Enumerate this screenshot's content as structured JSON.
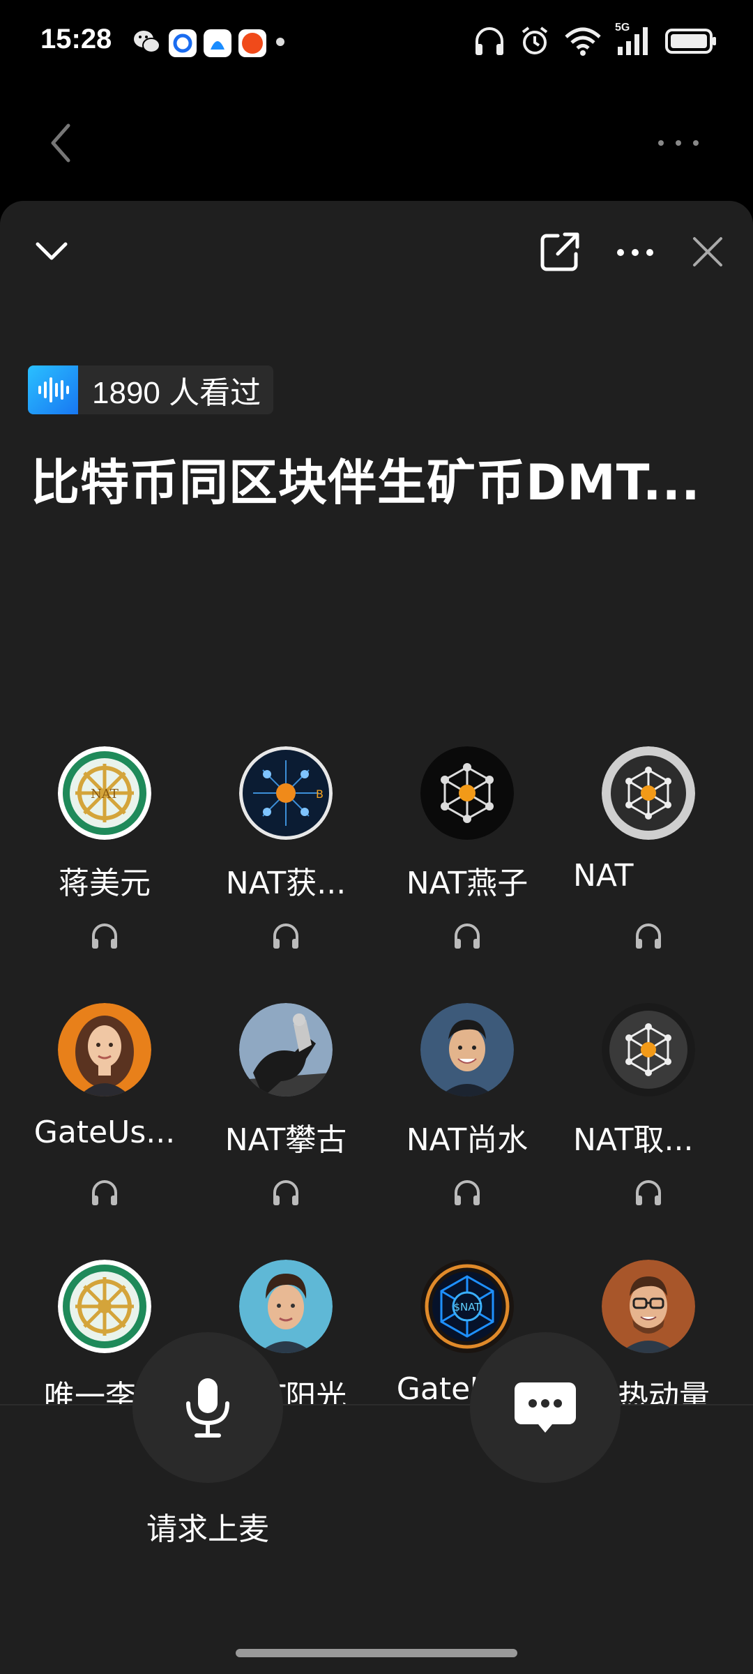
{
  "status_bar": {
    "time": "15:28",
    "network": "5G",
    "apps": [
      "wechat-icon",
      "app-blue-icon",
      "app-ai-icon",
      "app-red-icon"
    ]
  },
  "room": {
    "views_count": "1890 人看过",
    "title": "比特币同区块伴生矿币DMT..."
  },
  "members": [
    {
      "name": "蒋美元",
      "avatar": "jade-wheel-avatar"
    },
    {
      "name": "NAT获...",
      "avatar": "nat-circuit-avatar"
    },
    {
      "name": "NAT燕子",
      "avatar": "nat-network-avatar"
    },
    {
      "name": "NAT",
      "avatar": "nat-silver-avatar"
    },
    {
      "name": "GateUs...",
      "avatar": "woman-portrait-avatar"
    },
    {
      "name": "NAT攀古",
      "avatar": "horse-rider-avatar"
    },
    {
      "name": "NAT尚水",
      "avatar": "man-portrait-avatar"
    },
    {
      "name": "NAT取...",
      "avatar": "nat-silver-avatar"
    },
    {
      "name": "唯一李...",
      "avatar": "jade-wheel-avatar"
    },
    {
      "name": "NAT阳光",
      "avatar": "young-man-avatar"
    },
    {
      "name": "GateUs...",
      "avatar": "neon-nat-avatar"
    },
    {
      "name": "智热动量",
      "avatar": "glasses-man-avatar"
    }
  ],
  "controls": {
    "mic_label": "请求上麦"
  },
  "colors": {
    "background": "#000000",
    "sheet": "#1f1f1f",
    "button": "#2a2a2a",
    "accent_blue": "#1877f2"
  }
}
